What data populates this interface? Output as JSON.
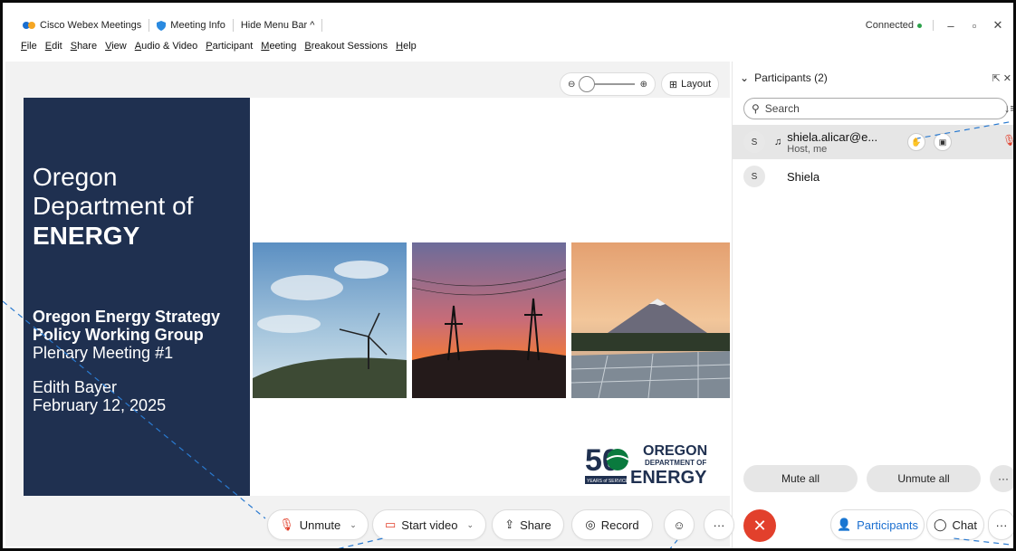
{
  "titlebar": {
    "app_name": "Cisco Webex Meetings",
    "meeting_info": "Meeting Info",
    "hide_menu": "Hide Menu Bar ^",
    "status": "Connected",
    "minimize": "–",
    "restore": "▫",
    "close": "✕"
  },
  "menu": [
    "File",
    "Edit",
    "Share",
    "View",
    "Audio & Video",
    "Participant",
    "Meeting",
    "Breakout Sessions",
    "Help"
  ],
  "view_controls": {
    "layout_label": "Layout"
  },
  "slide": {
    "org_line1": "Oregon",
    "org_line2": "Department of",
    "org_line3": "ENERGY",
    "group_line1": "Oregon Energy Strategy",
    "group_line2": "Policy Working Group",
    "meeting": "Plenary Meeting #1",
    "author": "Edith Bayer",
    "date": "February 12, 2025",
    "logo_number": "50",
    "logo_line1": "OREGON",
    "logo_line2": "DEPARTMENT OF",
    "logo_line3": "ENERGY",
    "logo_badge": "YEARS of SERVICE"
  },
  "toolbar": {
    "unmute": "Unmute",
    "start_video": "Start video",
    "share": "Share",
    "record": "Record",
    "participants": "Participants",
    "chat": "Chat"
  },
  "participants_panel": {
    "title": "Participants (2)",
    "search_placeholder": "Search",
    "participants": [
      {
        "initial": "S",
        "name": "shiela.alicar@e...",
        "role": "Host, me"
      },
      {
        "initial": "S",
        "name": "Shiela",
        "role": ""
      }
    ],
    "mute_all": "Mute all",
    "unmute_all": "Unmute all"
  },
  "colors": {
    "slide_navy": "#1f3050",
    "end_red": "#e2402c",
    "accent_blue": "#1b6fd0",
    "connected_green": "#2ca24b"
  }
}
